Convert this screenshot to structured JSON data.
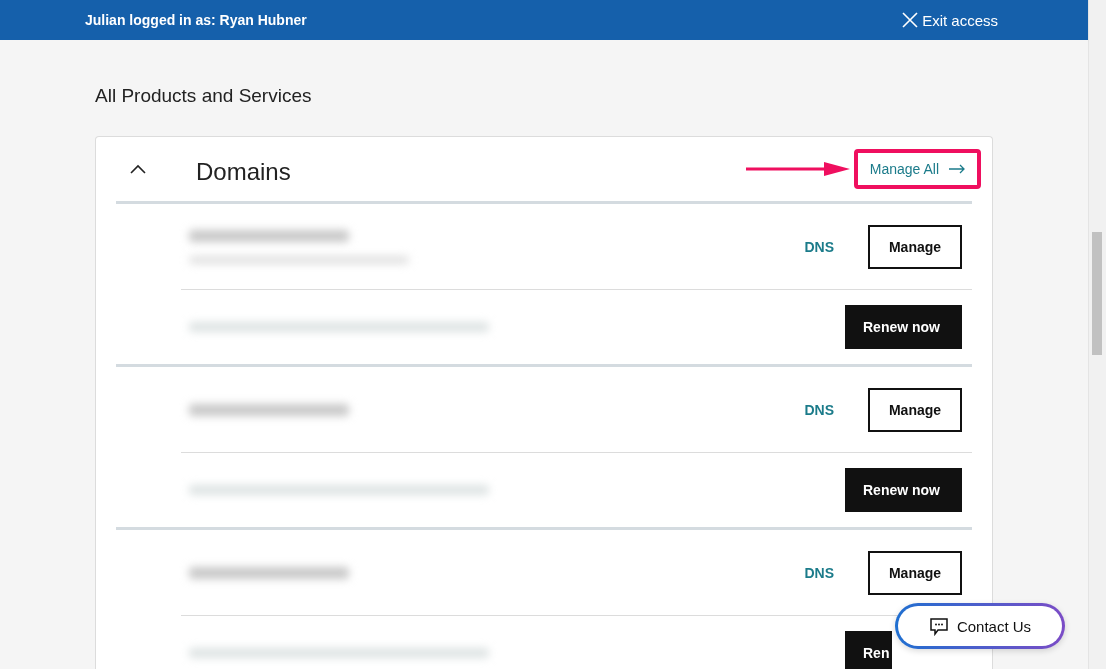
{
  "banner": {
    "text": "Julian logged in as: Ryan Hubner",
    "exit": "Exit access"
  },
  "heading": "All Products and Services",
  "section": {
    "title": "Domains",
    "expanded": true,
    "manage_all": "Manage All",
    "domains": [
      {
        "dns": "DNS",
        "manage": "Manage",
        "renew": "Renew now"
      },
      {
        "dns": "DNS",
        "manage": "Manage",
        "renew": "Renew now"
      },
      {
        "dns": "DNS",
        "manage": "Manage",
        "renew": "Ren"
      }
    ]
  },
  "contact": "Contact Us"
}
